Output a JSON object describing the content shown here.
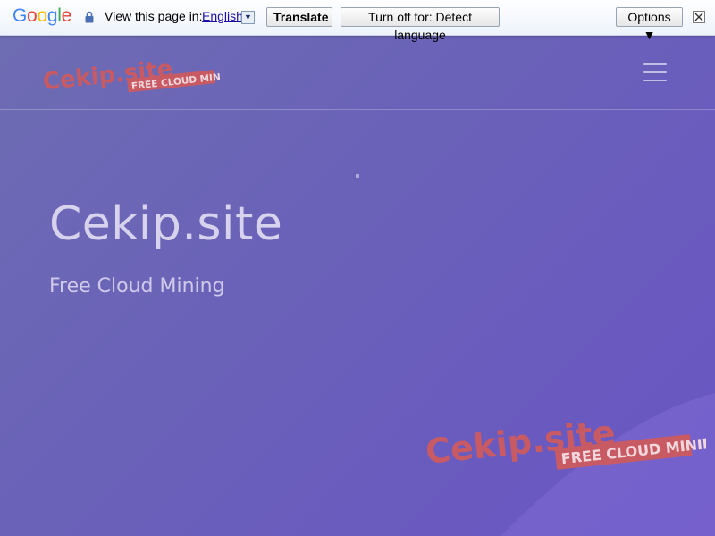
{
  "translate_bar": {
    "logo_letters": [
      {
        "char": "G",
        "color": "#4285f4"
      },
      {
        "char": "o",
        "color": "#ea4335"
      },
      {
        "char": "o",
        "color": "#fbbc05"
      },
      {
        "char": "g",
        "color": "#4285f4"
      },
      {
        "char": "l",
        "color": "#34a853"
      },
      {
        "char": "e",
        "color": "#ea4335"
      }
    ],
    "view_label": "View this page in:",
    "language": "English",
    "translate_label": "Translate",
    "turn_off_label": "Turn off for: Detect language",
    "options_label": "Options ▼"
  },
  "site": {
    "brand_name": "Cekip.site",
    "brand_tagline": "FREE CLOUD MINING",
    "hero_title": "Cekip.site",
    "hero_subtitle": "Free Cloud Mining",
    "watermark_name": "Cekip.site",
    "watermark_tagline": "FREE CLOUD MINING"
  },
  "colors": {
    "logo_red": "#c85a64",
    "hero_bg": "#6a62b8",
    "hero_text": "#d7d3ee"
  },
  "icons": {
    "lock": "lock-icon",
    "dropdown": "dropdown-arrow-icon",
    "close": "close-icon",
    "menu": "hamburger-menu-icon"
  }
}
